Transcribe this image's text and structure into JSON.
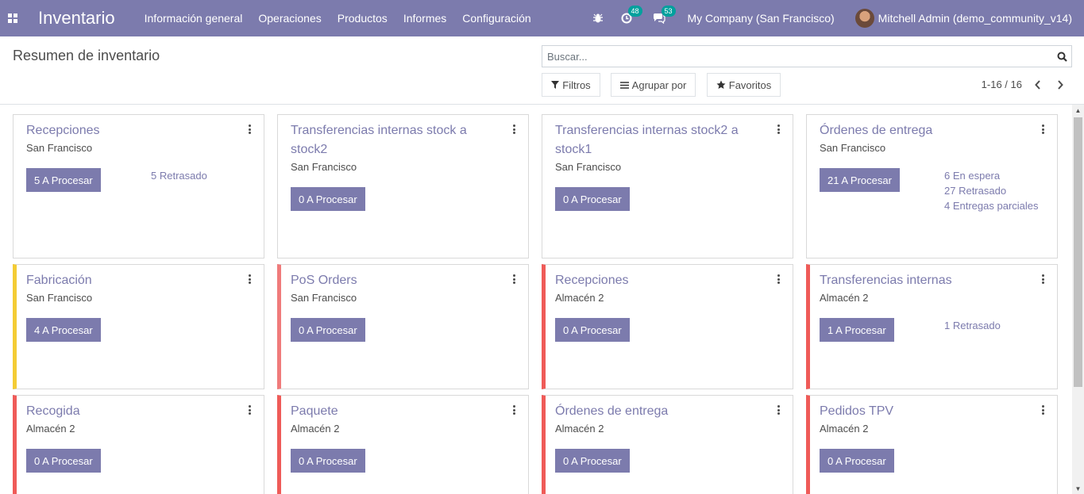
{
  "navbar": {
    "app_name": "Inventario",
    "menu": [
      "Información general",
      "Operaciones",
      "Productos",
      "Informes",
      "Configuración"
    ],
    "activity_count": "48",
    "message_count": "53",
    "company": "My Company (San Francisco)",
    "user": "Mitchell Admin (demo_community_v14)"
  },
  "control": {
    "title": "Resumen de inventario",
    "search_placeholder": "Buscar...",
    "filters_label": "Filtros",
    "group_label": "Agrupar por",
    "favorites_label": "Favoritos",
    "pager": "1-16 / 16"
  },
  "colors": {
    "brand": "#7c7bad",
    "badge": "#00a09d",
    "yellow": "#f4cc34",
    "red": "#ef5b58",
    "salmon": "#f07b7b"
  },
  "cards": [
    {
      "title": "Recepciones",
      "subtitle": "San Francisco",
      "button": "5 A Procesar",
      "stats": [
        "5 Retrasado"
      ],
      "color": ""
    },
    {
      "title": "Transferencias internas stock a stock2",
      "subtitle": "San Francisco",
      "button": "0 A Procesar",
      "stats": [],
      "color": ""
    },
    {
      "title": "Transferencias internas stock2 a stock1",
      "subtitle": "San Francisco",
      "button": "0 A Procesar",
      "stats": [],
      "color": ""
    },
    {
      "title": "Órdenes de entrega",
      "subtitle": "San Francisco",
      "button": "21 A Procesar",
      "stats": [
        "6 En espera",
        "27 Retrasado",
        "4 Entregas parciales"
      ],
      "color": ""
    },
    {
      "title": "Fabricación",
      "subtitle": "San Francisco",
      "button": "4 A Procesar",
      "stats": [],
      "color": "yellow"
    },
    {
      "title": "PoS Orders",
      "subtitle": "San Francisco",
      "button": "0 A Procesar",
      "stats": [],
      "color": "salmon"
    },
    {
      "title": "Recepciones",
      "subtitle": "Almacén 2",
      "button": "0 A Procesar",
      "stats": [],
      "color": "red"
    },
    {
      "title": "Transferencias internas",
      "subtitle": "Almacén 2",
      "button": "1 A Procesar",
      "stats": [
        "1 Retrasado"
      ],
      "color": "red"
    },
    {
      "title": "Recogida",
      "subtitle": "Almacén 2",
      "button": "0 A Procesar",
      "stats": [],
      "color": "red"
    },
    {
      "title": "Paquete",
      "subtitle": "Almacén 2",
      "button": "0 A Procesar",
      "stats": [],
      "color": "red"
    },
    {
      "title": "Órdenes de entrega",
      "subtitle": "Almacén 2",
      "button": "0 A Procesar",
      "stats": [],
      "color": "red"
    },
    {
      "title": "Pedidos TPV",
      "subtitle": "Almacén 2",
      "button": "0 A Procesar",
      "stats": [],
      "color": "red"
    }
  ]
}
